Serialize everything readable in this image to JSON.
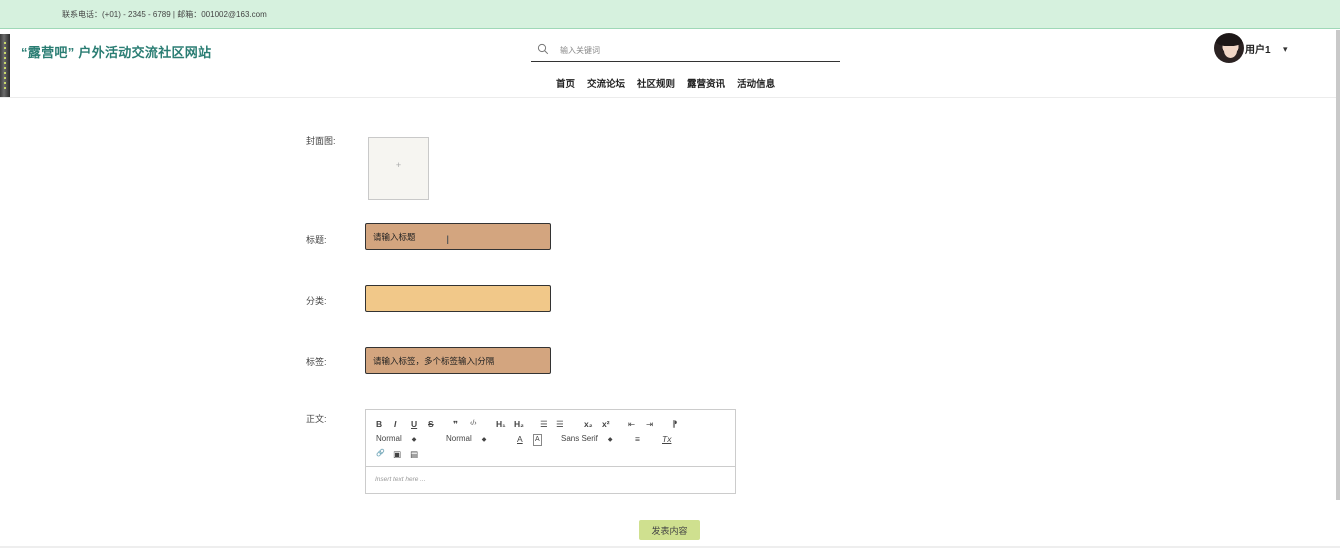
{
  "topbar": {
    "contact": "联系电话：(+01) - 2345 - 6789 | 邮箱：001002@163.com"
  },
  "header": {
    "site_title": "“露营吧” 户外活动交流社区网站",
    "search_placeholder": "输入关键词",
    "nav": [
      "首页",
      "交流论坛",
      "社区规则",
      "露营资讯",
      "活动信息"
    ],
    "user": {
      "name": "用户1",
      "caret": "▾"
    }
  },
  "form": {
    "cover_label": "封面图:",
    "cover_plus": "+",
    "title_label": "标题:",
    "title_placeholder": "请输入标题",
    "category_label": "分类:",
    "category_value": "",
    "tags_label": "标签:",
    "tags_placeholder": "请输入标签，多个标签输入|分隔",
    "body_label": "正文:",
    "editor": {
      "toolbar": {
        "bold": "B",
        "italic": "I",
        "underline": "U",
        "strike": "S",
        "quote": "❞",
        "code": "‹/›",
        "h1": "H₁",
        "h2": "H₂",
        "ordered_list": "☰",
        "bullet_list": "☰",
        "subscript": "x₂",
        "superscript": "x²",
        "indent_out": "⇤",
        "indent_in": "⇥",
        "direction": "⁋",
        "size_select": "Normal",
        "header_select": "Normal",
        "font_color": "A",
        "background_color": "A",
        "font_select": "Sans Serif",
        "align": "≡",
        "clean": "Tx",
        "link": "🔗",
        "image": "▣",
        "video": "▤"
      },
      "placeholder": "Insert text here ..."
    },
    "submit_label": "发表内容"
  },
  "colors": {
    "topbar": "#d6f1de",
    "title": "#2a7d73",
    "field_brown": "#d3a57f",
    "field_orange": "#f1c889",
    "submit": "#cfe08f"
  }
}
